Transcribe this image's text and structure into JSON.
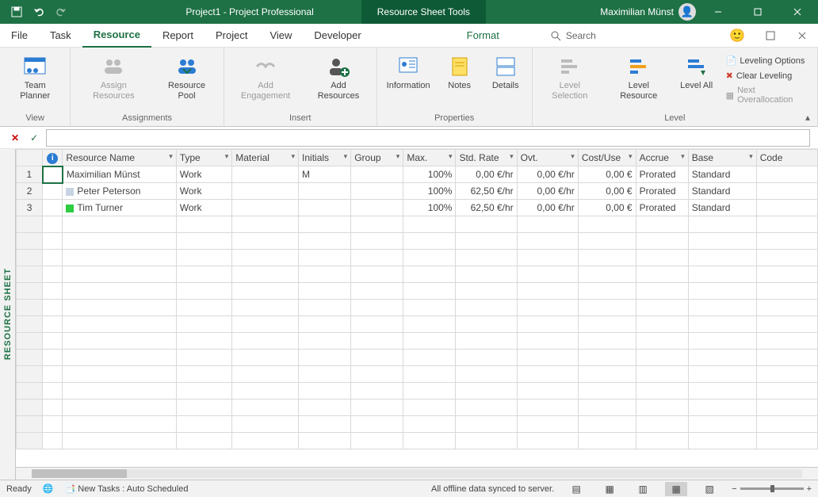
{
  "titlebar": {
    "doc_title": "Project1  -  Project Professional",
    "tool_tab": "Resource Sheet Tools",
    "user_name": "Maximilian Münst"
  },
  "tabs": {
    "file": "File",
    "task": "Task",
    "resource": "Resource",
    "report": "Report",
    "project": "Project",
    "view": "View",
    "developer": "Developer",
    "format": "Format",
    "search": "Search"
  },
  "ribbon": {
    "view": {
      "team_planner": "Team\nPlanner",
      "label": "View"
    },
    "assignments": {
      "assign": "Assign\nResources",
      "pool": "Resource\nPool",
      "label": "Assignments"
    },
    "insert": {
      "engagement": "Add\nEngagement",
      "add_res": "Add\nResources",
      "label": "Insert"
    },
    "properties": {
      "info": "Information",
      "notes": "Notes",
      "details": "Details",
      "label": "Properties"
    },
    "level": {
      "selection": "Level\nSelection",
      "resource": "Level\nResource",
      "all": "Level\nAll",
      "options": "Leveling Options",
      "clear": "Clear Leveling",
      "next": "Next Overallocation",
      "label": "Level"
    }
  },
  "side_tab": "RESOURCE SHEET",
  "columns": {
    "indicator": "",
    "name": "Resource Name",
    "type": "Type",
    "material": "Material",
    "initials": "Initials",
    "group": "Group",
    "max": "Max.",
    "std_rate": "Std. Rate",
    "ovt": "Ovt.",
    "cost_use": "Cost/Use",
    "accrue": "Accrue",
    "base": "Base",
    "code": "Code"
  },
  "rows": [
    {
      "num": "1",
      "chip": "",
      "name": "Maximilian Münst",
      "type": "Work",
      "material": "",
      "initials": "M",
      "group": "",
      "max": "100%",
      "std": "0,00 €/hr",
      "ovt": "0,00 €/hr",
      "cost": "0,00 €",
      "accrue": "Prorated",
      "base": "Standard",
      "code": ""
    },
    {
      "num": "2",
      "chip": "#c8d4e3",
      "name": "Peter Peterson",
      "type": "Work",
      "material": "",
      "initials": "",
      "group": "",
      "max": "100%",
      "std": "62,50 €/hr",
      "ovt": "0,00 €/hr",
      "cost": "0,00 €",
      "accrue": "Prorated",
      "base": "Standard",
      "code": ""
    },
    {
      "num": "3",
      "chip": "#2ecc40",
      "name": "Tim Turner",
      "type": "Work",
      "material": "",
      "initials": "",
      "group": "",
      "max": "100%",
      "std": "62,50 €/hr",
      "ovt": "0,00 €/hr",
      "cost": "0,00 €",
      "accrue": "Prorated",
      "base": "Standard",
      "code": ""
    }
  ],
  "status": {
    "ready": "Ready",
    "new_tasks": "New Tasks : Auto Scheduled",
    "sync": "All offline data synced to server."
  }
}
